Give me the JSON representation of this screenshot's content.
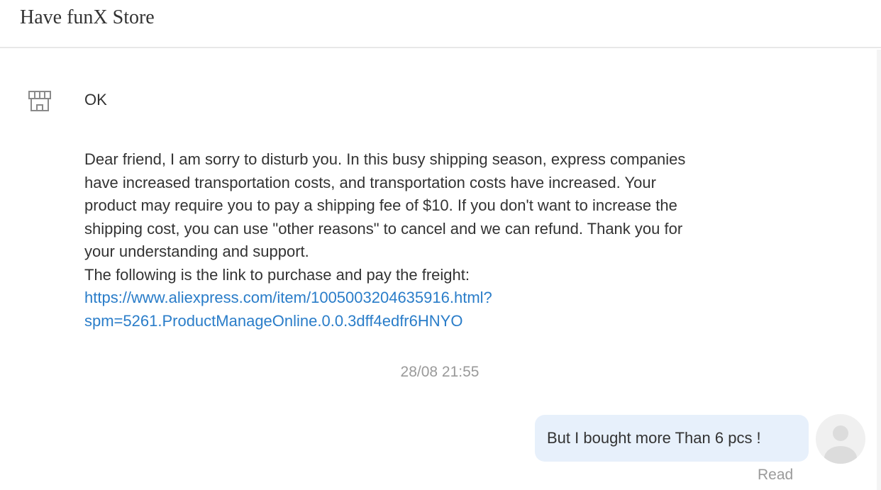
{
  "header": {
    "store_name": "Have funX Store"
  },
  "messages": {
    "ok": "OK",
    "long_lines": [
      "Dear friend, I am sorry to disturb you. In this busy shipping season, express companies",
      "have increased transportation costs, and transportation costs have increased. Your",
      "product may require you to pay a shipping fee of $10. If you don't want to increase the",
      "shipping cost, you can use \"other reasons\" to cancel and we can refund. Thank you for",
      "your understanding and support.",
      "The following is the link to purchase and pay the freight:"
    ],
    "link_lines": [
      "https://www.aliexpress.com/item/1005003204635916.html?",
      "spm=5261.ProductManageOnline.0.0.3dff4edfr6HNYO"
    ],
    "timestamp": "28/08 21:55",
    "reply": "But I bought more Than 6 pcs !",
    "reply_status": "Read"
  },
  "icons": {
    "store": "store-icon",
    "avatar": "user-avatar-icon"
  },
  "colors": {
    "link": "#2a7dc9",
    "bubble": "#e7f0fb",
    "muted": "#9a9a9a"
  }
}
